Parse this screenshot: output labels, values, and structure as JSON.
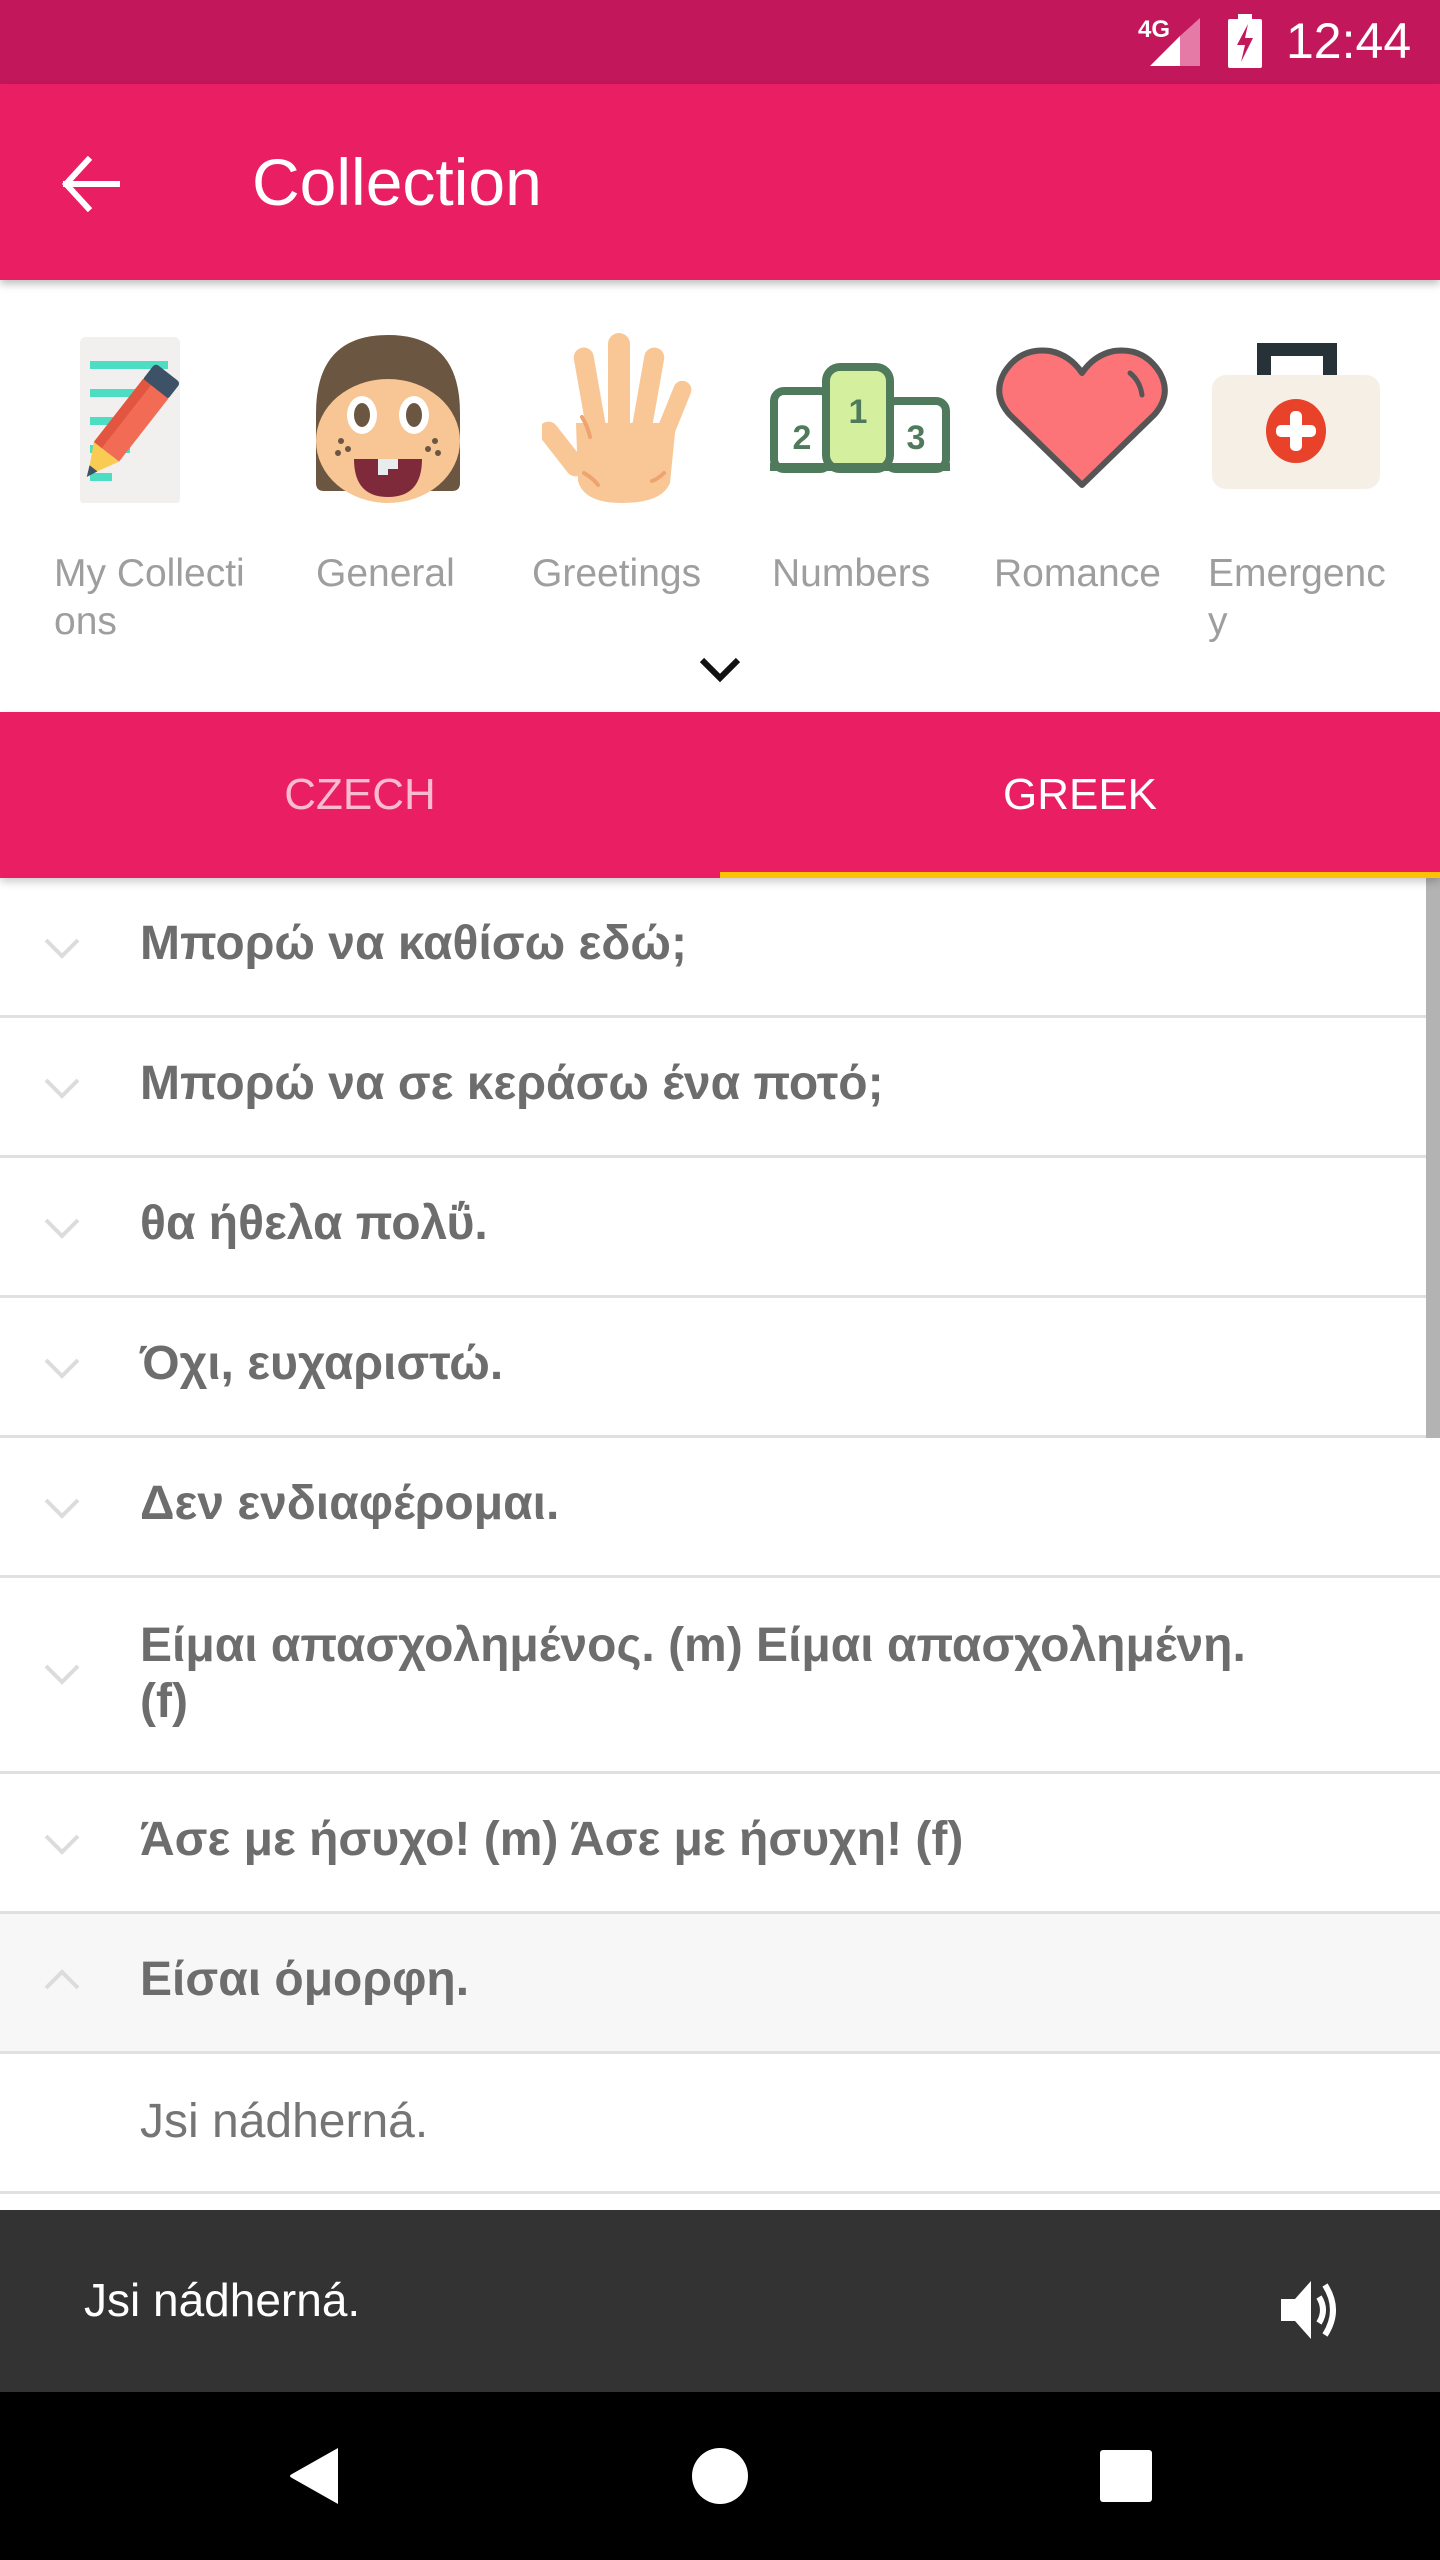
{
  "status_bar": {
    "network": "4G",
    "time": "12:44",
    "icons": [
      "signal-icon",
      "battery-charging-icon"
    ],
    "background": "#C2185B"
  },
  "toolbar": {
    "title": "Collection",
    "back_icon": "arrow-left-icon",
    "background": "#E91E63"
  },
  "categories": {
    "items": [
      {
        "label": "My Collections",
        "icon": "notepad-pencil-icon"
      },
      {
        "label": "General",
        "icon": "smiling-face-icon"
      },
      {
        "label": "Greetings",
        "icon": "waving-hand-icon"
      },
      {
        "label": "Numbers",
        "icon": "podium-icon"
      },
      {
        "label": "Romance",
        "icon": "heart-icon"
      },
      {
        "label": "Emergency",
        "icon": "first-aid-kit-icon"
      }
    ],
    "expand_icon": "chevron-down-icon"
  },
  "tabs": {
    "items": [
      {
        "label": "CZECH",
        "selected": false
      },
      {
        "label": "GREEK",
        "selected": true
      }
    ],
    "indicator_color": "#FFC107"
  },
  "phrases": [
    {
      "text": "Μπορώ να καθίσω εδώ;",
      "expanded": false
    },
    {
      "text": "Μπορώ να σε κεράσω ένα ποτό;",
      "expanded": false
    },
    {
      "text": "θα ήθελα πολΰ.",
      "expanded": false
    },
    {
      "text": "Όχι, ευχαριστώ.",
      "expanded": false
    },
    {
      "text": "Δεν ενδιαφέρομαι.",
      "expanded": false
    },
    {
      "text": "Είμαι απασχολημένος. (m)  Είμαι απασχολημένη. (f)",
      "expanded": false
    },
    {
      "text": "Άσε με ήσυχο! (m)  Άσε με ήσυχη! (f)",
      "expanded": false
    },
    {
      "text": "Είσαι όμορφη.",
      "expanded": true,
      "translation": "Jsi nádherná."
    }
  ],
  "player": {
    "text": "Jsi nádherná.",
    "icon": "speaker-icon"
  },
  "nav_bar": {
    "buttons": [
      "back-triangle-icon",
      "home-circle-icon",
      "recents-square-icon"
    ]
  }
}
